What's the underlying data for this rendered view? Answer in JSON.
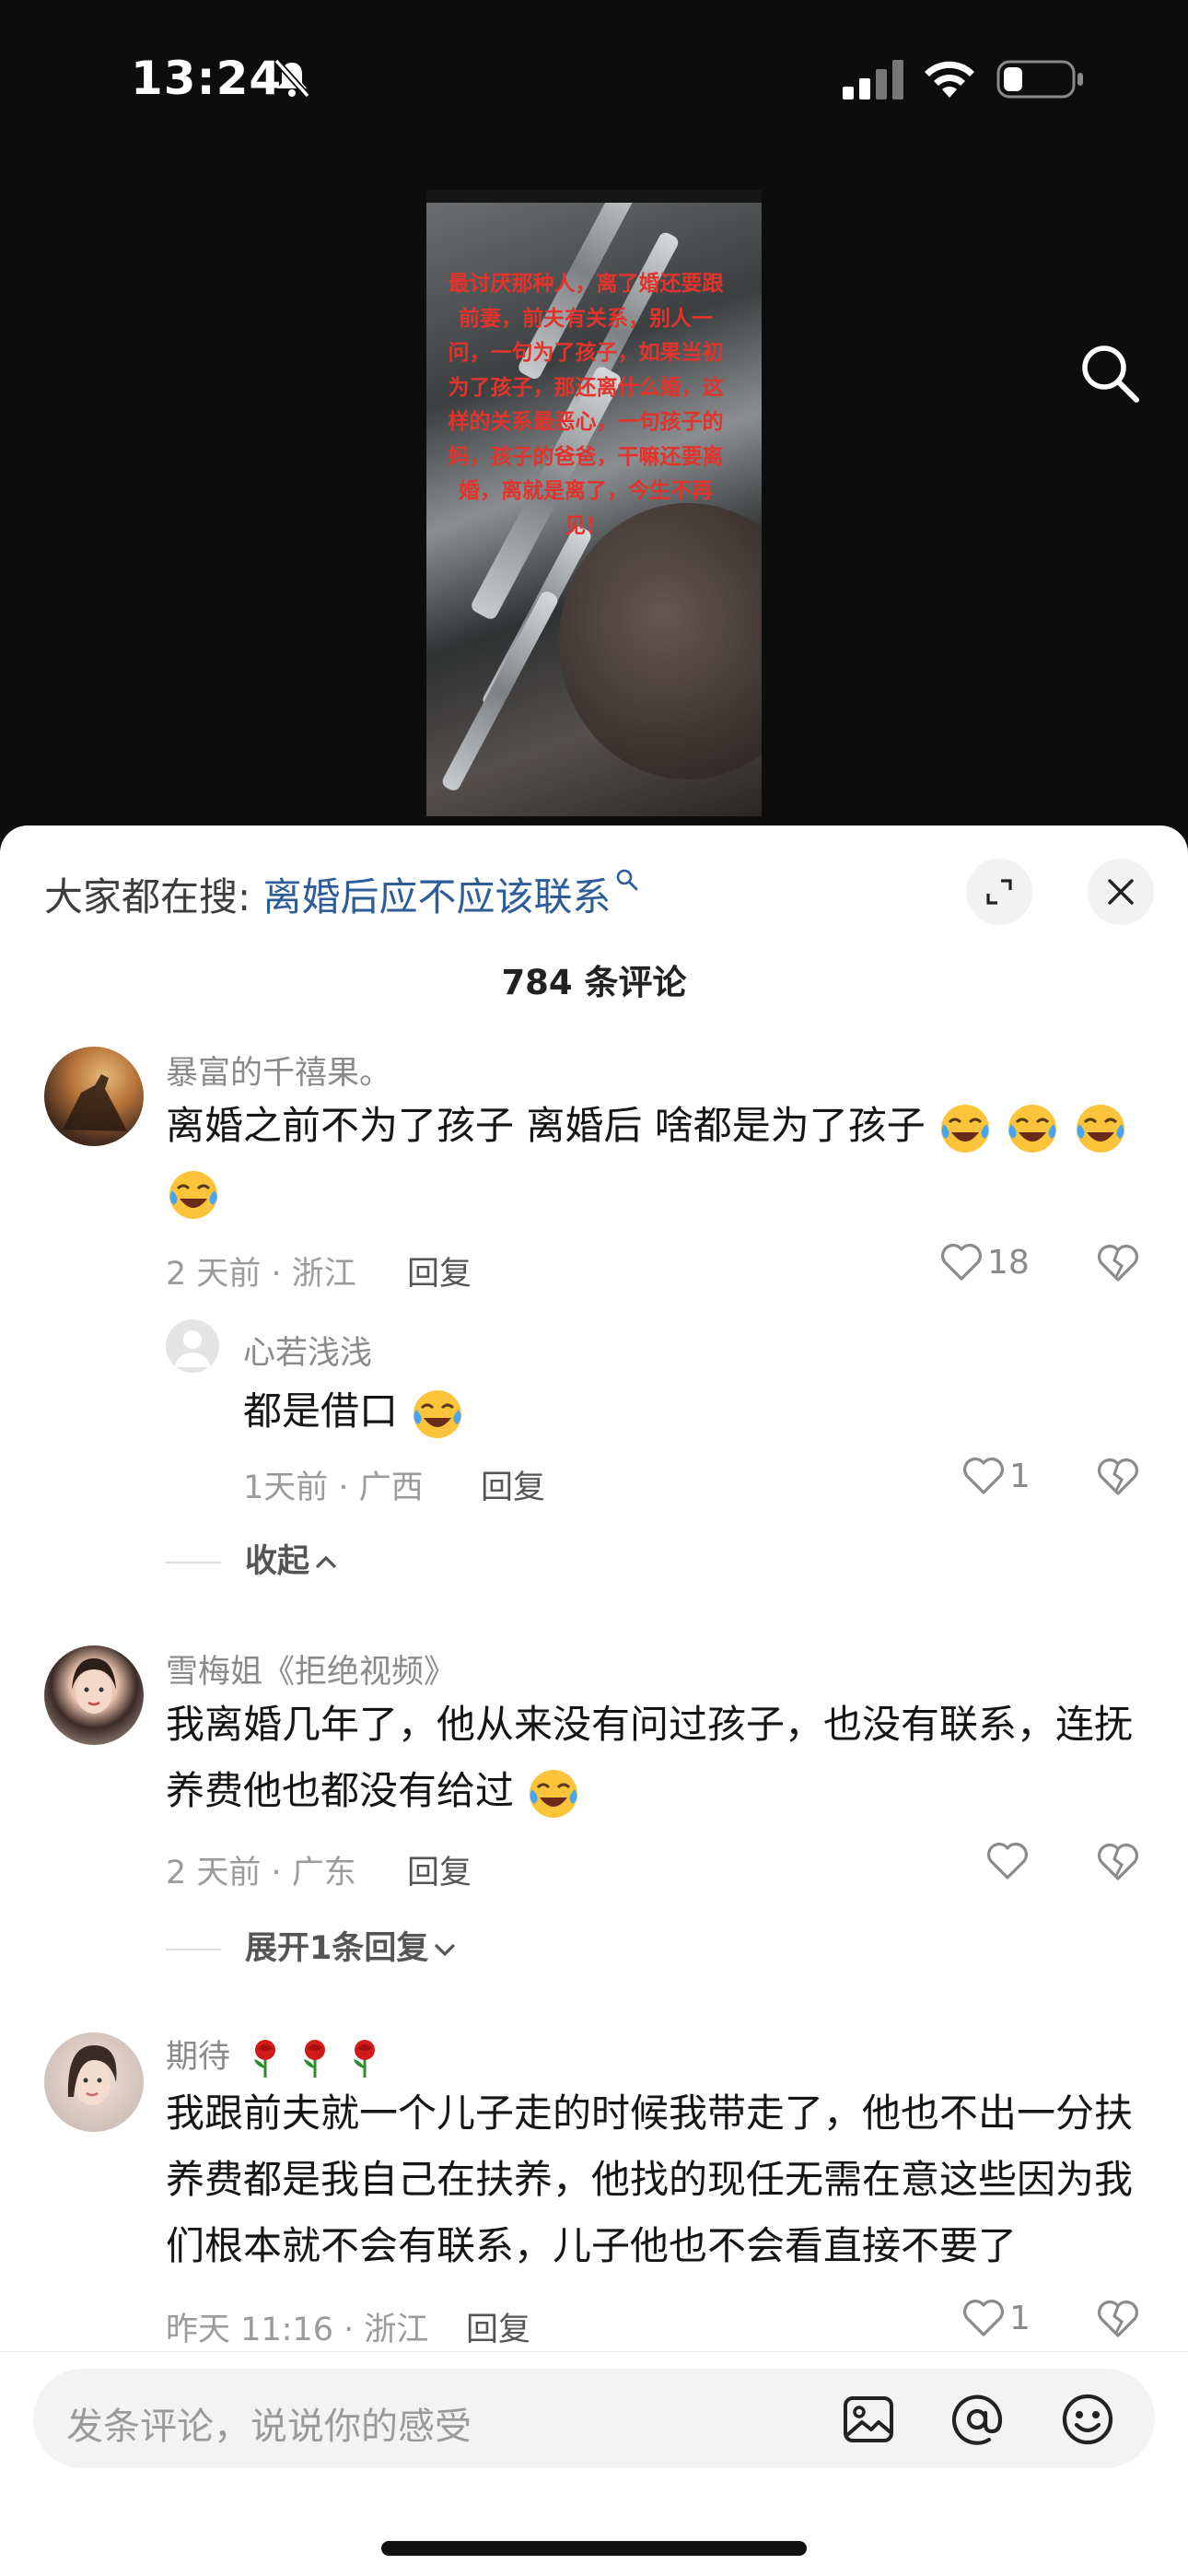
{
  "status_bar": {
    "time": "13:24"
  },
  "video": {
    "caption": "最讨厌那种人，离了婚还要跟前妻，前夫有关系，别人一问，一句为了孩子，如果当初为了孩子，那还离什么婚，这样的关系最恶心，一句孩子的妈，孩子的爸爸，干嘛还要离婚，离就是离了，今生不再见！"
  },
  "sheet": {
    "hot_search_prefix": "大家都在搜:",
    "hot_search_topic": "离婚后应不应该联系",
    "comment_count": "784 条评论"
  },
  "comments": [
    {
      "username": "暴富的千禧果。",
      "content": "离婚之前不为了孩子  离婚后 啥都是为了孩子",
      "meta": "2 天前 · 浙江",
      "reply_label": "回复",
      "likes": "18",
      "fold_label": "收起"
    },
    {
      "username": "心若浅浅",
      "content": "都是借口",
      "meta": "1天前 · 广西",
      "reply_label": "回复",
      "likes": "1"
    },
    {
      "username": "雪梅姐《拒绝视频》",
      "content": "我离婚几年了，他从来没有问过孩子，也没有联系，连抚养费他也都没有给过",
      "meta": "2 天前 · 广东",
      "reply_label": "回复",
      "likes": "",
      "expand_label": "展开1条回复"
    },
    {
      "username": "期待",
      "content": "我跟前夫就一个儿子走的时候我带走了，他也不出一分扶养费都是我自己在扶养，他找的现任无需在意这些因为我们根本就不会有联系，儿子他也不会看直接不要了",
      "meta": "昨天 11:16 · 浙江",
      "reply_label": "回复",
      "likes": "1"
    }
  ],
  "input_bar": {
    "placeholder": "发条评论，说说你的感受"
  },
  "icons": {
    "status": [
      "mute-icon",
      "signal-icon",
      "wifi-icon",
      "battery-icon"
    ],
    "sheet": [
      "search-icon",
      "expand-icon",
      "close-icon",
      "heart-icon",
      "broken-heart-icon",
      "chevron-up-icon",
      "chevron-down-icon"
    ],
    "input": [
      "image-icon",
      "at-icon",
      "emoji-icon"
    ],
    "emoji": "crying-laughing-emoji",
    "rose": "rose-emoji"
  },
  "colors": {
    "caption": "#e0342c",
    "topic_link": "#2d5c99",
    "sheet_bg": "#ffffff",
    "video_bg": "#0d0d0d"
  }
}
